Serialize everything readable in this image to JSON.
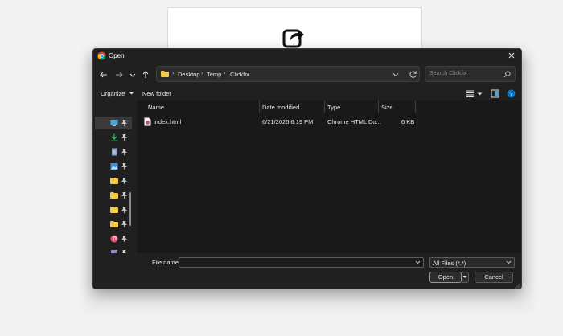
{
  "window": {
    "title": "Open"
  },
  "nav": {
    "path": [
      "Desktop",
      "Temp",
      "Clickfix"
    ],
    "search_placeholder": "Search Clickfix"
  },
  "toolbar": {
    "organize_label": "Organize",
    "new_folder_label": "New folder"
  },
  "sidebar": {
    "items": [
      {
        "icon": "desktop-icon",
        "color": "#4aa3df",
        "selected": true
      },
      {
        "icon": "download-icon",
        "color": "#35c46b"
      },
      {
        "icon": "document-icon",
        "color": "#8fa8c8"
      },
      {
        "icon": "pictures-icon",
        "color": "#3f8fd9"
      },
      {
        "icon": "folder-icon",
        "color": "#f2c94c"
      },
      {
        "icon": "folder-icon",
        "color": "#f2c94c"
      },
      {
        "icon": "folder-icon",
        "color": "#f2c94c"
      },
      {
        "icon": "folder-icon",
        "color": "#f2c94c"
      },
      {
        "icon": "music-icon",
        "color": "#e8556b"
      },
      {
        "icon": "video-icon",
        "color": "#9b7fc7"
      }
    ]
  },
  "columns": {
    "name": "Name",
    "date": "Date modified",
    "type": "Type",
    "size": "Size"
  },
  "files": [
    {
      "name": "index.html",
      "date": "6/21/2025 6:19 PM",
      "type": "Chrome HTML Do...",
      "size": "6 KB"
    }
  ],
  "footer": {
    "filename_label": "File name:",
    "filename_value": "",
    "filetype": "All Files (*.*)",
    "open_label": "Open",
    "cancel_label": "Cancel"
  },
  "colors": {
    "dialog_bg": "#202020",
    "list_bg": "#191919",
    "accent": "#0078d4",
    "folder": "#f2c94c"
  }
}
